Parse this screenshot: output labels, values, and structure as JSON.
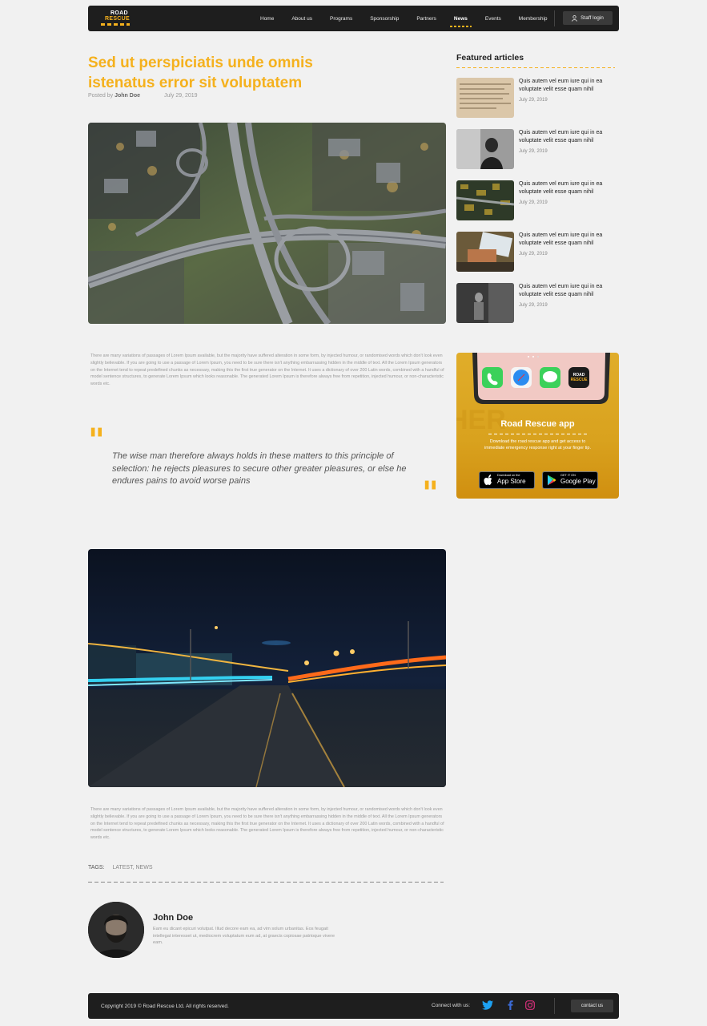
{
  "header": {
    "logo_line1": "ROAD",
    "logo_line2": "RESCUE",
    "nav": [
      "Home",
      "About us",
      "Programs",
      "Sponsorship",
      "Partners",
      "News",
      "Events",
      "Membership"
    ],
    "active_nav": "News",
    "staff_login": "Staff login"
  },
  "article": {
    "title": "Sed ut perspiciatis unde omnis istenatus error sit voluptatem",
    "posted_by_prefix": "Posted by",
    "author": "John Doe",
    "date": "July 29, 2019",
    "paragraph1": "There are many variations of passages of Lorem Ipsum available, but the majority have suffered alteration in some form, by injected humour, or randomised words which don't look even slightly believable. If you are going to use a passage of Lorem Ipsum, you need to be sure there isn't anything embarrassing hidden in the middle of text. All the Lorem Ipsum generators on the Internet tend to repeat predefined chunks as necessary, making this the first true generator on the Internet. It uses a dictionary of over 200 Latin words, combined with a handful of model sentence structures, to generate Lorem Ipsum which looks reasonable. The generated Lorem Ipsum is therefore always free from repetition, injected humour, or non-characteristic words etc.",
    "quote": "The wise man therefore always holds in these matters to this principle of selection: he rejects pleasures to secure other greater pleasures, or else he endures pains to avoid worse pains",
    "paragraph2": "There are many variations of passages of Lorem Ipsum available, but the majority have suffered alteration in some form, by injected humour, or randomised words which don't look even slightly believable. If you are going to use a passage of Lorem Ipsum, you need to be sure there isn't anything embarrassing hidden in the middle of text. All the Lorem Ipsum generators on the Internet tend to repeat predefined chunks as necessary, making this the first true generator on the Internet. It uses a dictionary of over 200 Latin words, combined with a handful of model sentence structures, to generate Lorem Ipsum which looks reasonable. The generated Lorem Ipsum is therefore always free from repetition, injected humour, or non-characteristic words etc.",
    "tags_label": "TAGS:",
    "tags": "LATEST, NEWS"
  },
  "author_box": {
    "name": "John Doe",
    "bio": "Eam eu dicant epicuri volutpat. Illud decore eam ea, ad vim solum urbanitas. Eos feugait intellegat interesset ut, mediocrem voluptatum eum ad, at graecis copiosae patrioque vivere eam."
  },
  "sidebar": {
    "featured_heading": "Featured articles",
    "featured": [
      {
        "title": "Quis autem vel eum iure qui in ea voluptate velit esse quam nihil",
        "date": "July 29, 2019"
      },
      {
        "title": "Quis autem vel eum iure qui in ea voluptate velit esse quam nihil",
        "date": "July 29, 2019"
      },
      {
        "title": "Quis autem vel eum iure qui in ea voluptate velit esse quam nihil",
        "date": "July 29, 2019"
      },
      {
        "title": "Quis autem vel eum iure qui in ea voluptate velit esse quam nihil",
        "date": "July 29, 2019"
      },
      {
        "title": "Quis autem vel eum iure qui in ea voluptate velit esse quam nihil",
        "date": "July 29, 2019"
      }
    ],
    "app": {
      "title": "Road Rescue app",
      "description": "Download the road rescue app and get access to immediate emergency response right at your finger tip.",
      "appstore_small": "Download on the",
      "appstore_big": "App Store",
      "googleplay_small": "GET IT ON",
      "googleplay_big": "Google Play"
    }
  },
  "footer": {
    "copyright": "Copyright 2019 © Road Rescue Ltd.  All rights reserved.",
    "connect": "Connect with us:",
    "contact": "contact us",
    "social_icons": [
      "twitter-icon",
      "facebook-icon",
      "instagram-icon"
    ]
  },
  "colors": {
    "accent": "#f5b11d",
    "dark": "#1e1e1e",
    "background": "#f1f1f1"
  }
}
